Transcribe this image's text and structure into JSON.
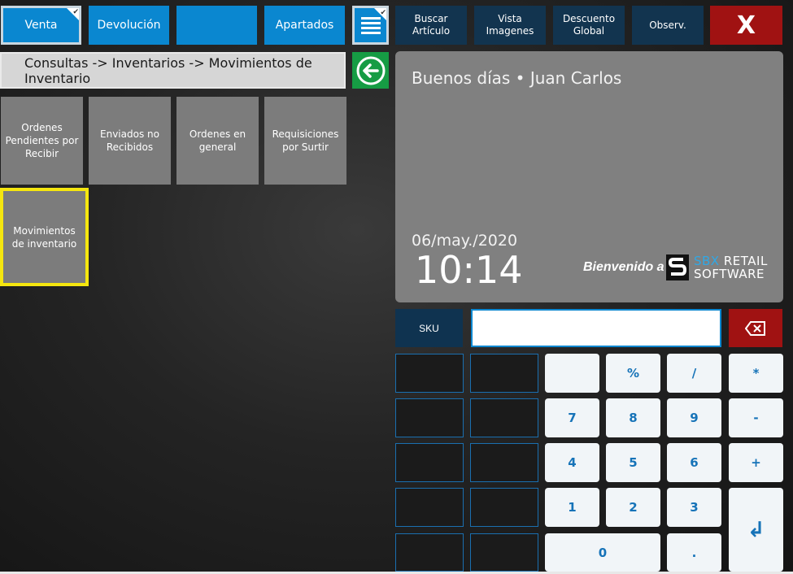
{
  "modes": [
    {
      "label": "Venta",
      "active": true
    },
    {
      "label": "Devolución",
      "active": false
    },
    {
      "label": "",
      "active": false
    },
    {
      "label": "Apartados",
      "active": false
    }
  ],
  "menu_icon": "list-icon",
  "functions": [
    {
      "line1": "Buscar",
      "line2": "Artículo"
    },
    {
      "line1": "Vista",
      "line2": "Imagenes"
    },
    {
      "line1": "Descuento",
      "line2": "Global"
    },
    {
      "line1": "Observ.",
      "line2": ""
    }
  ],
  "close_label": "X",
  "breadcrumb": "Consultas -> Inventarios -> Movimientos de Inventario",
  "back_icon": "arrow-left-icon",
  "tiles": [
    {
      "label": "Ordenes Pendientes por Recibir"
    },
    {
      "label": "Enviados no Recibidos"
    },
    {
      "label": "Ordenes en general"
    },
    {
      "label": "Requisiciones por Surtir"
    },
    {
      "label": "Movimientos de inventario",
      "selected": true
    }
  ],
  "welcome": {
    "greeting": "Buenos días • Juan Carlos",
    "date": "06/may./2020",
    "time": "10:14",
    "bienvenido": "Bienvenido a",
    "logo_line1_blue": "SBX",
    "logo_line1_white": "RETAIL",
    "logo_line2": "SOFTWARE"
  },
  "sku": {
    "label": "SKU",
    "value": "",
    "placeholder": ""
  },
  "keypad": {
    "row1": [
      "",
      "%",
      "/",
      "*"
    ],
    "row2": [
      "7",
      "8",
      "9",
      "-"
    ],
    "row3": [
      "4",
      "5",
      "6",
      "+"
    ],
    "row4": [
      "1",
      "2",
      "3"
    ],
    "row5": [
      "0",
      "."
    ],
    "enter_symbol": "↲"
  },
  "colors": {
    "accent_blue": "#0a87d0",
    "dark_navy": "#12344f",
    "danger_red": "#a01212",
    "back_green": "#169c44",
    "selected_yellow": "#f5e60f"
  }
}
